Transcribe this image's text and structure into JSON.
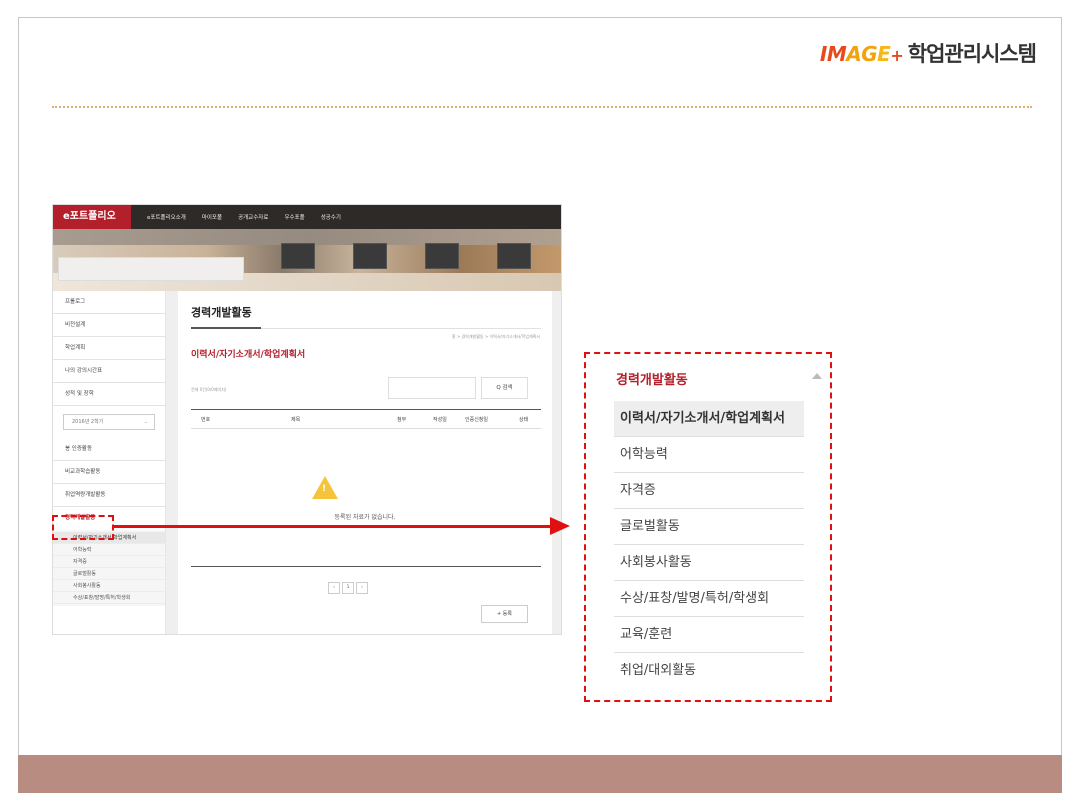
{
  "logo": {
    "img1": "IM",
    "img2": "AG",
    "img3": "E",
    "plus": "+",
    "text": "학업관리시스템"
  },
  "colors": {
    "accent": "#b3202c",
    "highlight": "#e01010",
    "footer": "#b88c80"
  },
  "screenshot": {
    "brand": "e포트폴리오",
    "nav": [
      "e포트폴리오소개",
      "마이포폴",
      "공개교수자료",
      "우수포폴",
      "성공수기"
    ],
    "sidebar": {
      "items": [
        "프롤로그",
        "비전설계",
        "학업계획",
        "나의 강의시간표",
        "성적 및 장학"
      ],
      "semester": "2016년 2학기",
      "items2": [
        "봉 인증활동",
        "비교과학습활동",
        "취업역량개발활동"
      ],
      "active": "경력개발활동",
      "sub": [
        "이력서/자기소개서/학업계획서",
        "어학능력",
        "자격증",
        "글로벌활동",
        "사회봉사활동",
        "수상/표창/발명/특허/학생회"
      ]
    },
    "page_title": "경력개발활동",
    "breadcrumb": "홈 > 경력개발활동 > 이력서/자기소개서/학업계획서",
    "section_title": "이력서/자기소개서/학업계획서",
    "count_text": "전체 0건(0/0페이지)",
    "search_button": "Q 검색",
    "columns": [
      "번호",
      "제목",
      "첨부",
      "작성일",
      "인증신청일",
      "상태"
    ],
    "empty_message": "등록된 자료가 없습니다.",
    "pager": [
      "‹",
      "1",
      "›"
    ],
    "register_button": "+ 등록"
  },
  "zoom": {
    "title": "경력개발활동",
    "items": [
      "이력서/자기소개서/학업계획서",
      "어학능력",
      "자격증",
      "글로벌활동",
      "사회봉사활동",
      "수상/표창/발명/특허/학생회",
      "교육/훈련",
      "취업/대외활동"
    ]
  }
}
